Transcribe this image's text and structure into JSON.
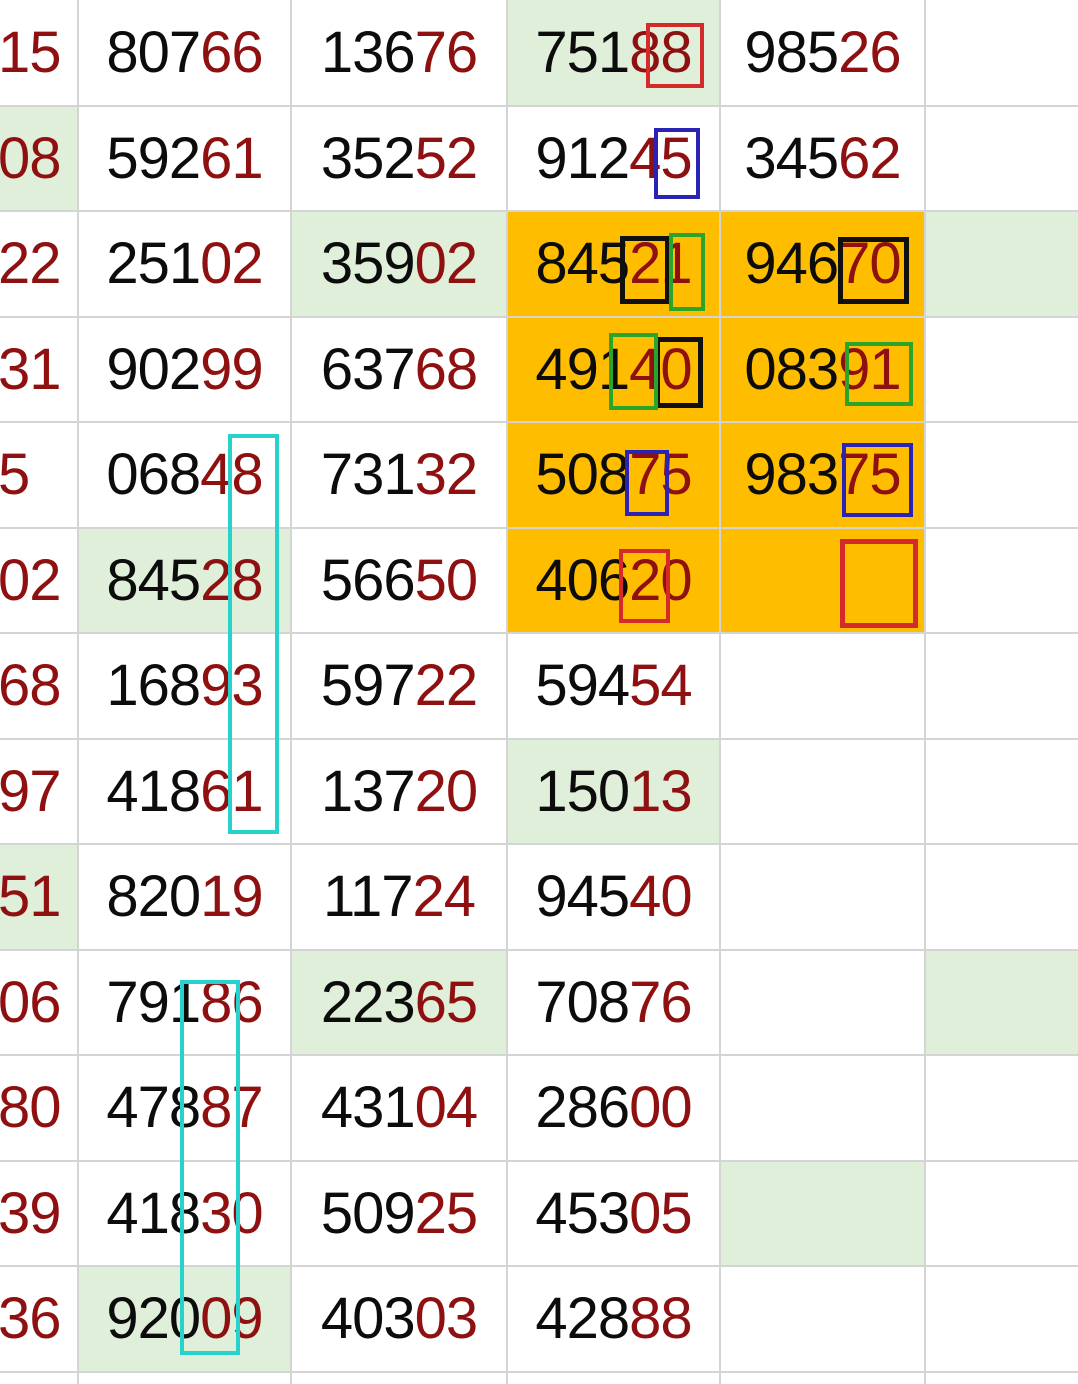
{
  "colors": {
    "green": "#dfefd9",
    "orange": "#ffbd00",
    "dark_red_digits": "#8f1010",
    "black_digits": "#0c0c0c"
  },
  "col0": [
    "15",
    "08",
    "22",
    "31",
    "5",
    "02",
    "68",
    "97",
    "51",
    "06",
    "80",
    "39",
    "36"
  ],
  "rows": [
    [
      "80766",
      "13676",
      "75188",
      "98526"
    ],
    [
      "59261",
      "35252",
      "91245",
      "34562"
    ],
    [
      "25102",
      "35902",
      "84521",
      "94670"
    ],
    [
      "90299",
      "63768",
      "49140",
      "08391"
    ],
    [
      "06848",
      "73132",
      "50875",
      "98375"
    ],
    [
      "84528",
      "56650",
      "40620",
      ""
    ],
    [
      "16893",
      "59722",
      "59454",
      ""
    ],
    [
      "41861",
      "13720",
      "15013",
      ""
    ],
    [
      "82019",
      "11724",
      "94540",
      ""
    ],
    [
      "79186",
      "22365",
      "70876",
      ""
    ],
    [
      "47887",
      "43104",
      "28600",
      ""
    ],
    [
      "41830",
      "50925",
      "45305",
      ""
    ],
    [
      "92009",
      "40303",
      "42888",
      ""
    ]
  ],
  "fills": {
    "green": [
      [
        0,
        3
      ],
      [
        1,
        0
      ],
      [
        2,
        2
      ],
      [
        2,
        5
      ],
      [
        5,
        1
      ],
      [
        7,
        3
      ],
      [
        8,
        0
      ],
      [
        9,
        2
      ],
      [
        9,
        5
      ],
      [
        11,
        4
      ],
      [
        12,
        1
      ]
    ],
    "orange": [
      [
        2,
        3
      ],
      [
        2,
        4
      ],
      [
        3,
        3
      ],
      [
        3,
        4
      ],
      [
        4,
        3
      ],
      [
        4,
        4
      ],
      [
        5,
        3
      ],
      [
        5,
        4
      ]
    ]
  },
  "mark_colors": {
    "red": "#d42a2a",
    "blue": "#2a23b4",
    "black": "#101010",
    "green": "#2aa52a",
    "cyan": "#27d2cc"
  }
}
